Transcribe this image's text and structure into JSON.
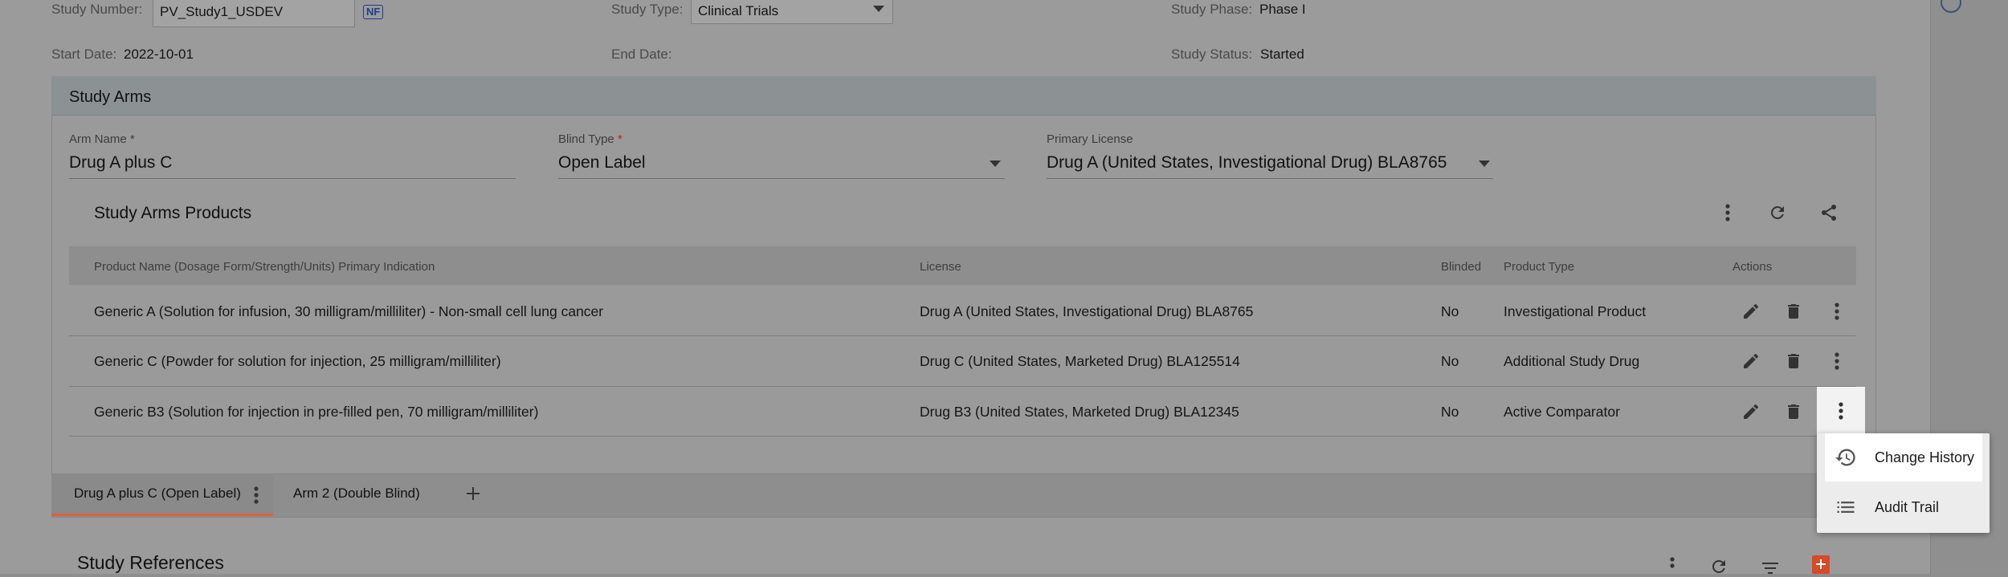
{
  "study": {
    "number_label": "Study Number:",
    "number_value": "PV_Study1_USDEV",
    "nf_badge": "NF",
    "type_label": "Study Type:",
    "type_value": "Clinical Trials",
    "phase_label": "Study Phase:",
    "phase_value": "Phase I",
    "start_label": "Start Date:",
    "start_value": "2022-10-01",
    "end_label": "End Date:",
    "end_value": "",
    "status_label": "Study Status:",
    "status_value": "Started"
  },
  "arms": {
    "title": "Study Arms",
    "arm_name_label": "Arm Name",
    "arm_name_value": "Drug A plus C",
    "blind_type_label": "Blind Type",
    "blind_type_value": "Open Label",
    "primary_license_label": "Primary License",
    "primary_license_value": "Drug A (United States, Investigational Drug) BLA8765",
    "required_mark": "*"
  },
  "products": {
    "title": "Study Arms Products",
    "columns": {
      "product": "Product Name (Dosage Form/Strength/Units) Primary Indication",
      "license": "License",
      "blinded": "Blinded",
      "product_type": "Product Type",
      "actions": "Actions"
    },
    "rows": [
      {
        "product": "Generic A (Solution for infusion, 30 milligram/milliliter) - Non-small cell lung cancer",
        "license": "Drug A (United States, Investigational Drug) BLA8765",
        "blinded": "No",
        "product_type": "Investigational Product"
      },
      {
        "product": "Generic C (Powder for solution for injection, 25 milligram/milliliter)",
        "license": "Drug C (United States, Marketed Drug) BLA125514",
        "blinded": "No",
        "product_type": "Additional Study Drug"
      },
      {
        "product": "Generic B3 (Solution for injection in pre-filled pen, 70 milligram/milliliter)",
        "license": "Drug B3 (United States, Marketed Drug) BLA12345",
        "blinded": "No",
        "product_type": "Active Comparator"
      }
    ]
  },
  "tabs": [
    {
      "label": "Drug A plus C (Open Label)",
      "active": true
    },
    {
      "label": "Arm 2 (Double Blind)",
      "active": false
    }
  ],
  "context_menu": {
    "items": [
      {
        "label": "Change History",
        "icon": "history-icon"
      },
      {
        "label": "Audit Trail",
        "icon": "list-icon"
      }
    ]
  },
  "references": {
    "title": "Study References"
  },
  "colors": {
    "accent": "#e0603f",
    "menu_bg": "#ececec",
    "badge": "#1d3e8a"
  }
}
